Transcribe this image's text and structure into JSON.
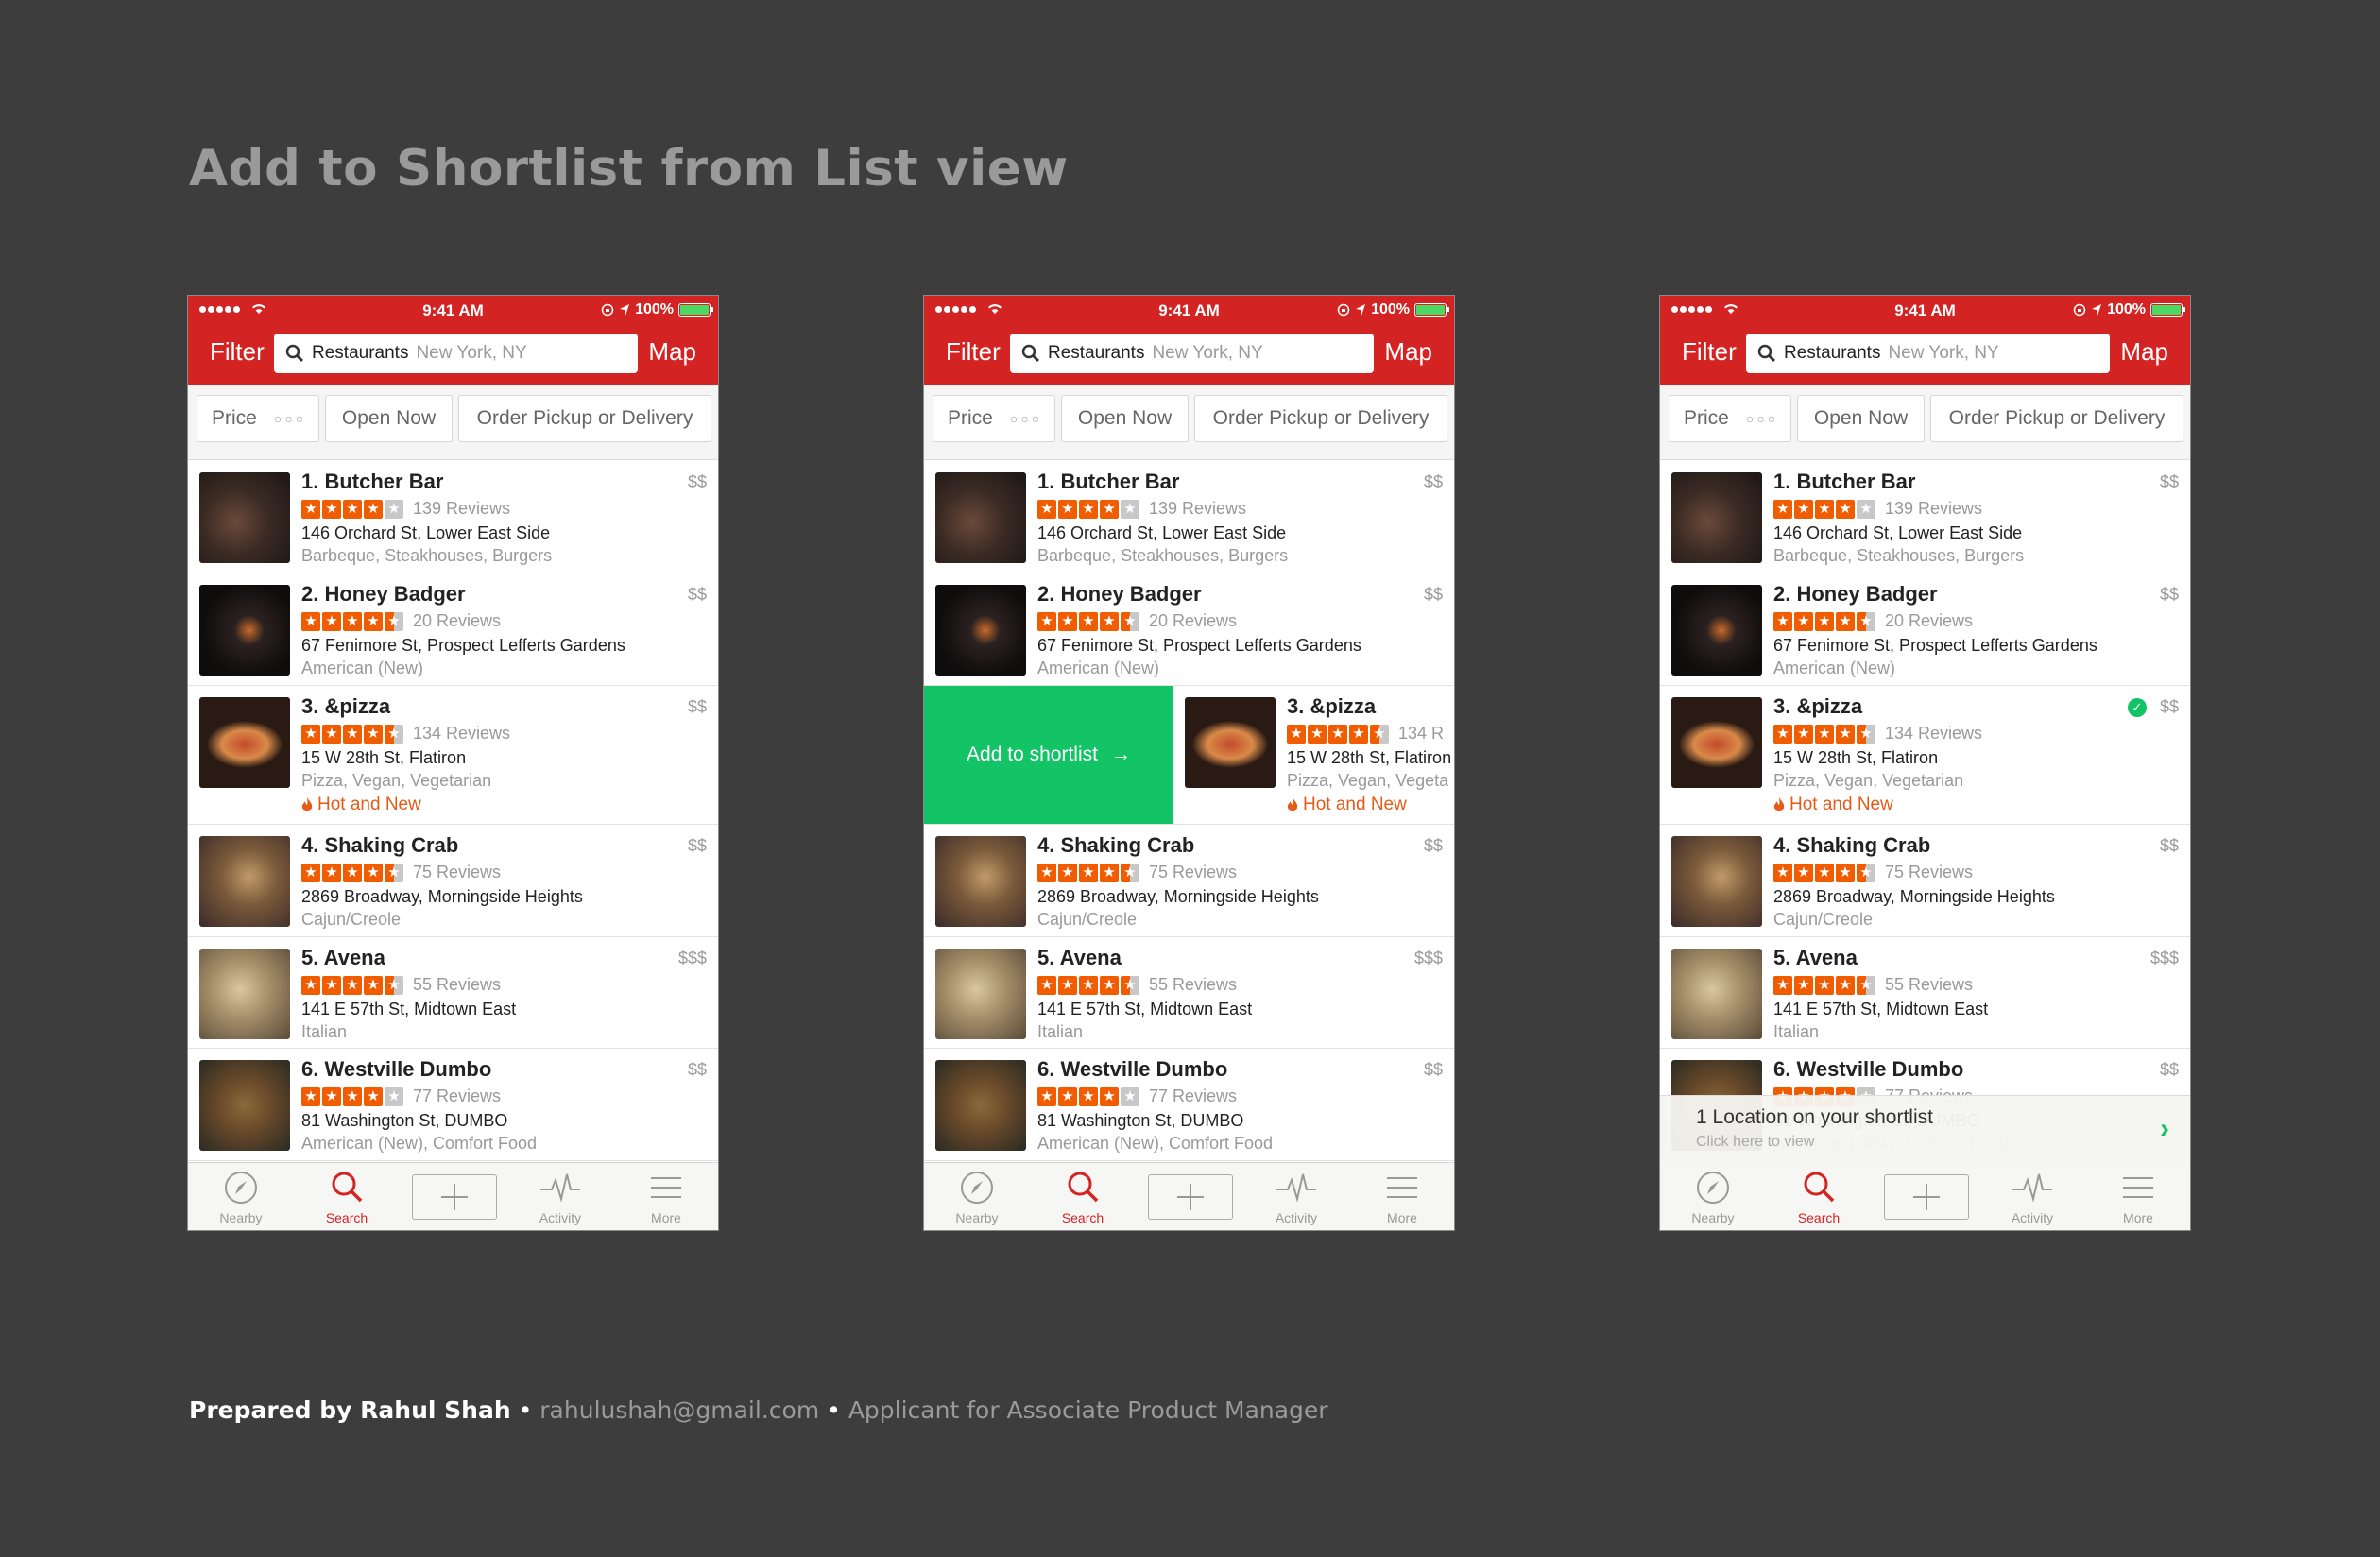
{
  "slide": {
    "title": "Add to Shortlist from List view",
    "footer_author": "Prepared by Rahul Shah",
    "footer_sep": "•",
    "footer_email": "rahulushah@gmail.com",
    "footer_role": "Applicant for Associate Product Manager"
  },
  "phone": {
    "status": {
      "time": "9:41 AM",
      "battery": "100%"
    },
    "nav": {
      "filter": "Filter",
      "query": "Restaurants",
      "location": "New York, NY",
      "map": "Map"
    },
    "filters": {
      "price": "Price",
      "open_now": "Open Now",
      "order": "Order Pickup or Delivery"
    },
    "tabs": [
      {
        "label": "Nearby",
        "icon": "compass-icon"
      },
      {
        "label": "Search",
        "icon": "search-icon",
        "active": true
      },
      {
        "label": "",
        "icon": "plus-icon"
      },
      {
        "label": "Activity",
        "icon": "activity-icon"
      },
      {
        "label": "More",
        "icon": "menu-icon"
      }
    ],
    "listings": [
      {
        "name": "1. Butcher Bar",
        "price": "$$",
        "rating": 4,
        "reviews": "139 Reviews",
        "address": "146 Orchard St, Lower East Side",
        "categories": "Barbeque, Steakhouses, Burgers"
      },
      {
        "name": "2. Honey Badger",
        "price": "$$",
        "rating": 4.5,
        "reviews": "20 Reviews",
        "address": "67 Fenimore St, Prospect Lefferts Gardens",
        "categories": "American (New)"
      },
      {
        "name": "3. &pizza",
        "price": "$$",
        "rating": 4.5,
        "reviews": "134 Reviews",
        "address": "15 W 28th St, Flatiron",
        "categories": "Pizza, Vegan, Vegetarian",
        "badge": "Hot and New"
      },
      {
        "name": "4. Shaking Crab",
        "price": "$$",
        "rating": 4.5,
        "reviews": "75 Reviews",
        "address": "2869 Broadway, Morningside Heights",
        "categories": "Cajun/Creole"
      },
      {
        "name": "5. Avena",
        "price": "$$$",
        "rating": 4.5,
        "reviews": "55 Reviews",
        "address": "141 E 57th St, Midtown East",
        "categories": "Italian"
      },
      {
        "name": "6. Westville Dumbo",
        "price": "$$",
        "rating": 4,
        "reviews": "77 Reviews",
        "address": "81 Washington St, DUMBO",
        "categories": "American (New), Comfort Food"
      }
    ],
    "swipe_action": "Add to shortlist",
    "swipe_arrow": "→",
    "partial_reviews": "134 R",
    "partial_address": "15 W 28th St, Flatiron",
    "partial_categories": "Pizza, Vegan, Vegeta",
    "shortlist_toast": {
      "title": "1 Location on your shortlist",
      "subtitle": "Click here to view",
      "arrow": "›"
    },
    "check_mark": "✓"
  }
}
